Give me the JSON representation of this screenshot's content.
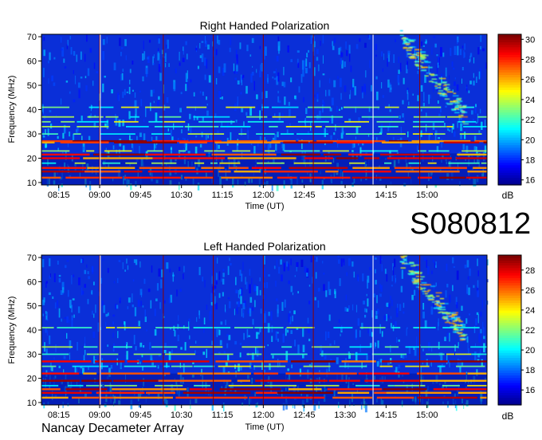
{
  "station_id": "S080812",
  "observatory": "Nancay Decameter Array",
  "colormap": [
    "#00008f",
    "#0000ff",
    "#007fff",
    "#00ffff",
    "#7fff7f",
    "#ffff00",
    "#ff7f00",
    "#ff0000",
    "#7f0000"
  ],
  "chart_data": [
    {
      "type": "heatmap",
      "title": "Right Handed Polarization",
      "xlabel": "Time (UT)",
      "ylabel": "Frequency (MHz)",
      "x_ticks": [
        "08:15",
        "09:00",
        "09:45",
        "10:30",
        "11:15",
        "12:00",
        "12:45",
        "13:30",
        "14:15",
        "15:00"
      ],
      "y_ticks": [
        10,
        20,
        30,
        40,
        50,
        60,
        70
      ],
      "ylim": [
        9,
        71
      ],
      "time_range": [
        "07:56",
        "16:06"
      ],
      "colorbar": {
        "label": "dB",
        "ticks": [
          16,
          18,
          20,
          22,
          24,
          26,
          28,
          30
        ],
        "range": [
          15.5,
          30.5
        ]
      },
      "strong_bands_mhz": [
        27,
        26.5,
        21.5,
        20,
        16,
        14.5,
        12
      ],
      "moderate_bands_mhz": [
        41,
        37,
        35,
        33,
        30,
        23,
        18
      ]
    },
    {
      "type": "heatmap",
      "title": "Left Handed Polarization",
      "xlabel": "Time (UT)",
      "ylabel": "Frequency (MHz)",
      "x_ticks": [
        "08:15",
        "09:00",
        "09:45",
        "10:30",
        "11:15",
        "12:00",
        "12:45",
        "13:30",
        "14:15",
        "15:00"
      ],
      "y_ticks": [
        10,
        20,
        30,
        40,
        50,
        60,
        70
      ],
      "ylim": [
        9,
        71
      ],
      "time_range": [
        "07:56",
        "16:06"
      ],
      "colorbar": {
        "label": "dB",
        "ticks": [
          16,
          18,
          20,
          22,
          24,
          26,
          28
        ],
        "range": [
          14.5,
          29.5
        ]
      },
      "strong_bands_mhz": [
        27,
        22,
        19,
        15.5,
        14,
        12
      ],
      "moderate_bands_mhz": [
        41,
        33,
        30,
        25,
        17
      ]
    }
  ]
}
